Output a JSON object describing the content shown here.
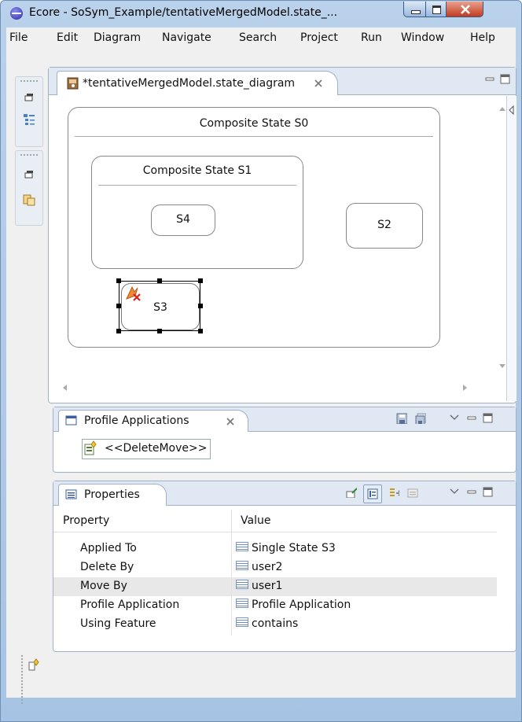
{
  "window": {
    "title": "Ecore - SoSym_Example/tentativeMergedModel.state_..."
  },
  "menu": [
    "File",
    "Edit",
    "Diagram",
    "Navigate",
    "Search",
    "Project",
    "Run",
    "Window",
    "Help"
  ],
  "editor": {
    "tab_label": "*tentativeMergedModel.state_diagram",
    "diagram": {
      "composite_s0": "Composite State S0",
      "composite_s1": "Composite State S1",
      "s4": "S4",
      "s2": "S2",
      "s3": "S3"
    }
  },
  "profile_view": {
    "tab_label": "Profile Applications",
    "item": "<<DeleteMove>>"
  },
  "properties_view": {
    "tab_label": "Properties",
    "columns": [
      "Property",
      "Value"
    ],
    "rows": [
      {
        "property": "Applied To",
        "value": "Single State S3"
      },
      {
        "property": "Delete By",
        "value": "user2"
      },
      {
        "property": "Move By",
        "value": "user1"
      },
      {
        "property": "Profile Application",
        "value": "Profile Application"
      },
      {
        "property": "Using Feature",
        "value": "contains"
      }
    ]
  },
  "icons": {
    "app": "eclipse-icon",
    "trim": [
      "restore-icon",
      "outline-icon",
      "restore-icon",
      "package-explorer-icon"
    ],
    "profile_toolbar": [
      "save-icon",
      "save-all-icon"
    ],
    "properties_toolbar": [
      "pin-icon",
      "categories-icon",
      "advanced-icon",
      "restore-default-icon"
    ]
  },
  "colors": {
    "accent": "#a7c3e3",
    "selection_row": "#e8e8e8",
    "close": "#c43b1f"
  }
}
